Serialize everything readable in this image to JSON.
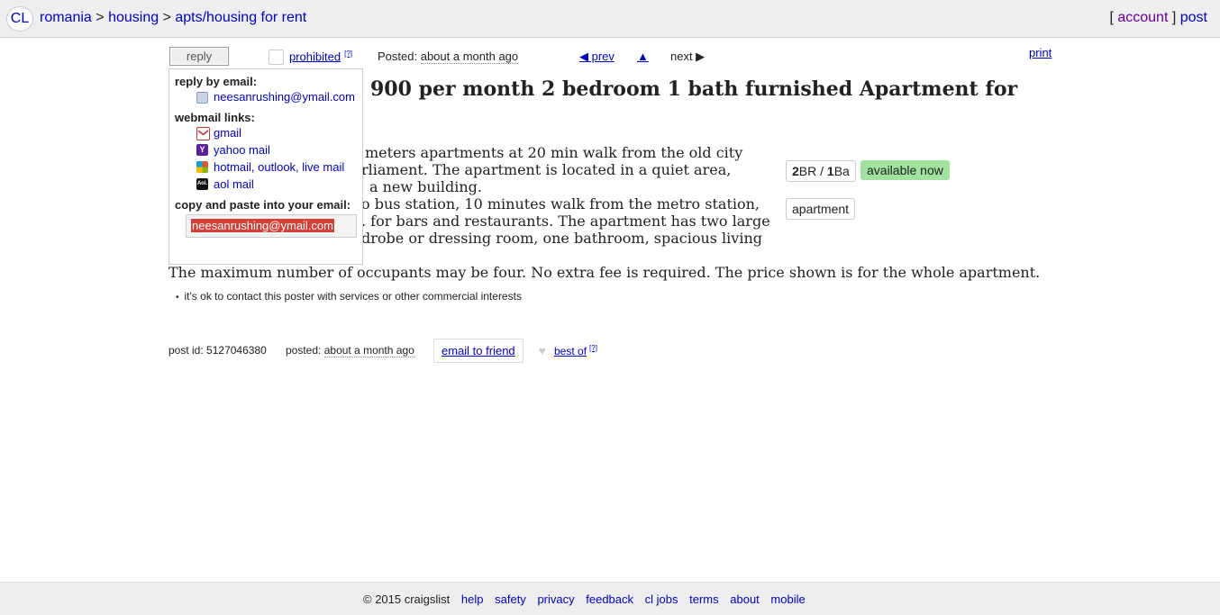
{
  "header": {
    "logo": "CL",
    "breadcrumb": [
      "romania",
      "housing",
      "apts/housing for rent"
    ],
    "sep": ">",
    "account": "account",
    "post": "post",
    "bracket_open": "[",
    "bracket_close": "]"
  },
  "toolbar": {
    "reply_label": "reply",
    "prohibited": "prohibited",
    "help_mark": "[?]",
    "posted_label": "Posted:",
    "posted_value": "about a month ago",
    "prev": "◀ prev",
    "up": "▲",
    "next": "next ▶",
    "print": "print"
  },
  "reply_popup": {
    "by_email_heading": "reply by email:",
    "email": "neesanrushing@ymail.com",
    "webmail_heading": "webmail links:",
    "webmail": [
      "gmail",
      "yahoo mail",
      "hotmail, outlook, live mail",
      "aol mail"
    ],
    "copy_heading": "copy and paste into your email:",
    "copy_value": "neesanrushing@ymail.com",
    "icons": [
      "contact-card-icon",
      "gmail-icon",
      "yahoo-icon",
      "windows-live-icon",
      "aol-icon"
    ],
    "aol_icon_text": "Aol."
  },
  "posting": {
    "title": "900 per month 2 bedroom 1 bath furnished Apartment for",
    "body_lines": [
      "meters apartments at 20 min walk from the old city",
      "rliament. The apartment is located in a quiet area,",
      "a new building.",
      "o bus station, 10 minutes walk from the metro station,",
      ". for bars and restaurants. The apartment has two large",
      "drobe or dressing room, one bathroom, spacious living",
      "The maximum number of occupants may be four. No extra fee is required. The price shown is for the whole apartment."
    ],
    "attrs": {
      "bedrooms": "2",
      "br_label": "BR / ",
      "baths": "1",
      "ba_label": "Ba",
      "availability": "available now",
      "type": "apartment"
    },
    "notice": "it's ok to contact this poster with services or other commercial interests",
    "bullet": "•",
    "post_id_label": "post id:",
    "post_id": "5127046380",
    "posted_label": "posted:",
    "posted_value": "about a month ago",
    "email_friend": "email to friend",
    "heart": "♥",
    "best_of": "best of"
  },
  "footer": {
    "copyright": "© 2015 craigslist",
    "links": [
      "help",
      "safety",
      "privacy",
      "feedback",
      "cl jobs",
      "terms",
      "about",
      "mobile"
    ]
  },
  "colors": {
    "link": "#0000cc",
    "availability_bg": "#9fe39f",
    "selection_bg": "#d44033"
  }
}
